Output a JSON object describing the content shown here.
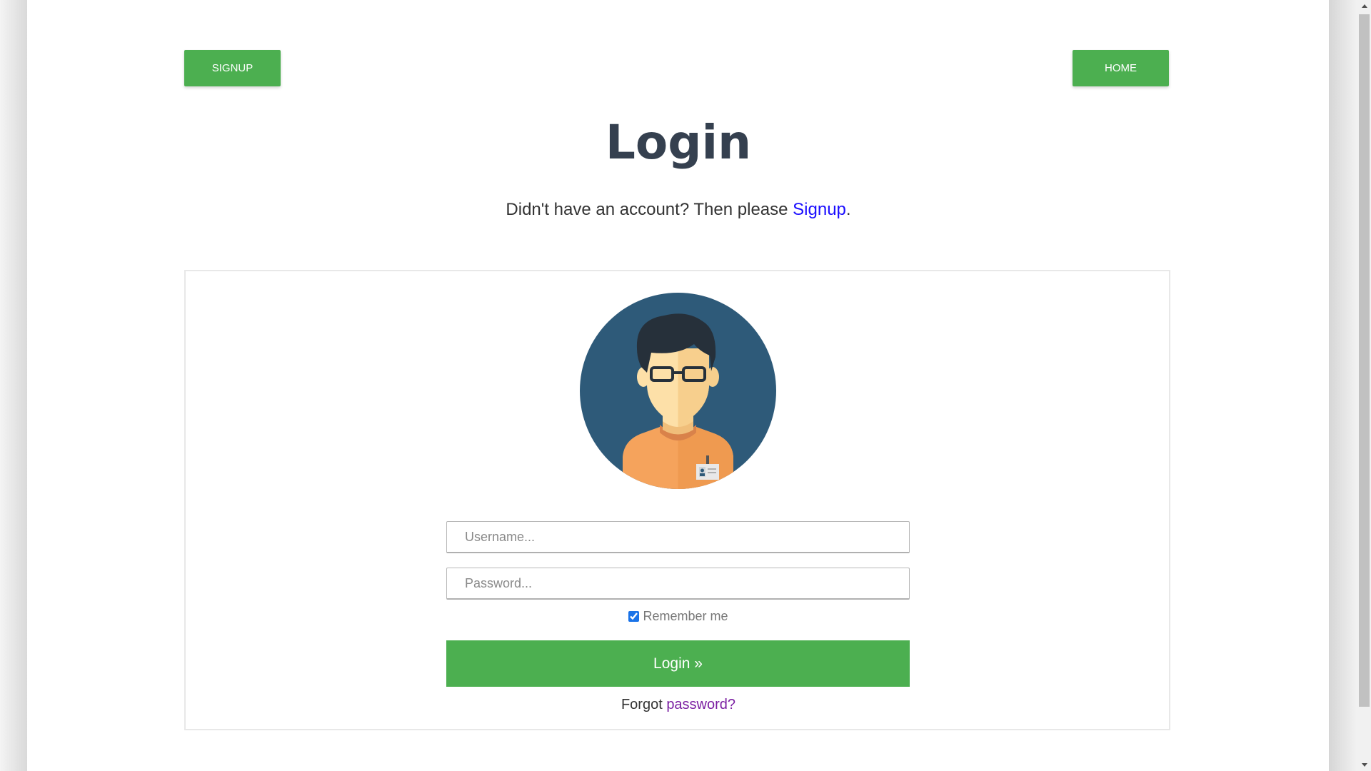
{
  "nav": {
    "signup_label": "SIGNUP",
    "home_label": "HOME"
  },
  "heading": {
    "title": "Login",
    "prompt_text": "Didn't have an account? Then please ",
    "prompt_link": "Signup",
    "prompt_suffix": "."
  },
  "form": {
    "username_placeholder": "Username...",
    "username_value": "",
    "password_placeholder": "Password...",
    "password_value": "",
    "remember_label": "Remember me",
    "remember_checked": true,
    "submit_label": "Login »",
    "forgot_prefix": "Forgot ",
    "forgot_link": "password?"
  },
  "icons": {
    "avatar": "user-avatar-icon"
  },
  "colors": {
    "accent_green": "#4caf50",
    "title": "#35404f",
    "signup_link": "#1a0dff",
    "forgot_link": "#7b1fa2",
    "avatar_bg": "#2e5a79",
    "shirt": "#f5a35c"
  }
}
